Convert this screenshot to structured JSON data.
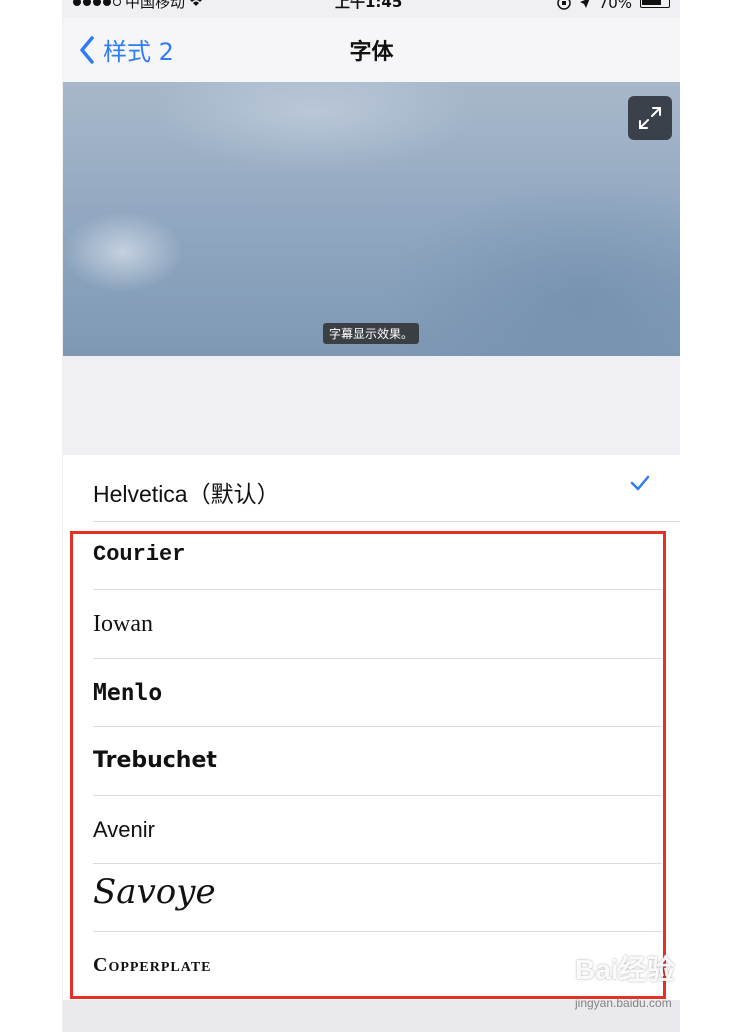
{
  "status_bar": {
    "carrier": "中国移动",
    "time": "上午1:45",
    "battery": "70%",
    "icons": [
      "signal-dots",
      "wifi-icon",
      "orientation-lock-icon",
      "location-arrow-icon",
      "battery-icon"
    ]
  },
  "nav": {
    "back_label": "样式 2",
    "title": "字体"
  },
  "preview": {
    "subtitle_sample": "字幕显示效果。",
    "expand_icon": "expand-icon"
  },
  "fonts": [
    {
      "label": "Helvetica（默认）",
      "selected": true
    },
    {
      "label": "Courier",
      "selected": false
    },
    {
      "label": "Iowan",
      "selected": false
    },
    {
      "label": "Menlo",
      "selected": false
    },
    {
      "label": "Trebuchet",
      "selected": false
    },
    {
      "label": "Avenir",
      "selected": false
    },
    {
      "label": "Savoye",
      "selected": false
    },
    {
      "label": "Copperplate",
      "selected": false
    }
  ],
  "colors": {
    "accent": "#2f7cf6",
    "highlight_border": "#e33127"
  },
  "watermark": {
    "logo": "Bai经验",
    "url": "jingyan.baidu.com"
  }
}
